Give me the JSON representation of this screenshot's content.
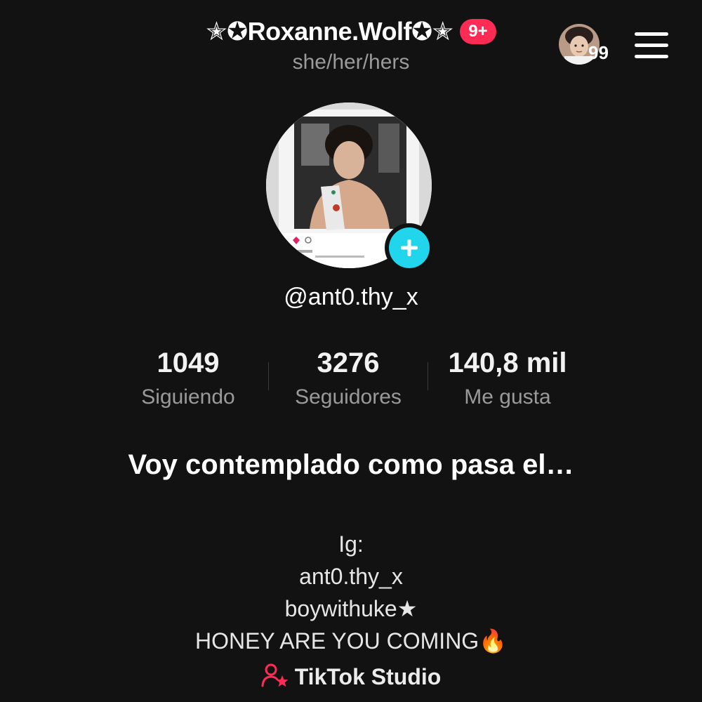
{
  "header": {
    "display_name": "✭✪Roxanne.Wolf✪✭",
    "notification_badge": "9+",
    "pronouns": "she/her/hers",
    "story_count": "99",
    "menu_icon": "hamburger-menu-icon"
  },
  "profile": {
    "username": "@ant0.thy_x",
    "add_icon": "plus-icon"
  },
  "stats": [
    {
      "value": "1049",
      "label": "Siguiendo"
    },
    {
      "value": "3276",
      "label": "Seguidores"
    },
    {
      "value": "140,8 mil",
      "label": "Me gusta"
    }
  ],
  "bio": {
    "headline": "Voy contemplado como pasa el…",
    "lines": [
      "Ig:",
      "ant0.thy_x",
      "boywithuke★",
      "HONEY ARE YOU COMING🔥"
    ]
  },
  "studio": {
    "label": "TikTok Studio",
    "icon": "person-star-icon"
  },
  "colors": {
    "background": "#121212",
    "badge": "#fe2c55",
    "add_button": "#20d5ec",
    "studio_icon": "#fe2c55"
  }
}
